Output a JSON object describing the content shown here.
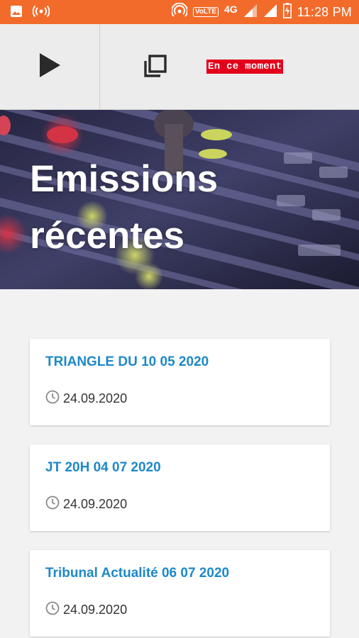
{
  "status_bar": {
    "time": "11:28 PM",
    "network": "4G",
    "volte": "VoLTE",
    "icons": [
      "image-icon",
      "broadcast-icon",
      "hotspot-icon",
      "volte-icon",
      "signal-icon",
      "signal-icon",
      "battery-charging-icon"
    ]
  },
  "player": {
    "play_icon": "play-icon",
    "copy_icon": "copy-icon",
    "now_label": "En ce moment",
    "now_color": "#e3001b"
  },
  "hero": {
    "title": "Emissions récentes"
  },
  "emissions": [
    {
      "title": "TRIANGLE DU 10 05 2020",
      "date": "24.09.2020"
    },
    {
      "title": "JT 20H 04 07 2020",
      "date": "24.09.2020"
    },
    {
      "title": "Tribunal Actualité 06 07 2020",
      "date": "24.09.2020"
    }
  ],
  "colors": {
    "status_bar": "#f26b2b",
    "link": "#1e88c9",
    "badge": "#e3001b"
  }
}
